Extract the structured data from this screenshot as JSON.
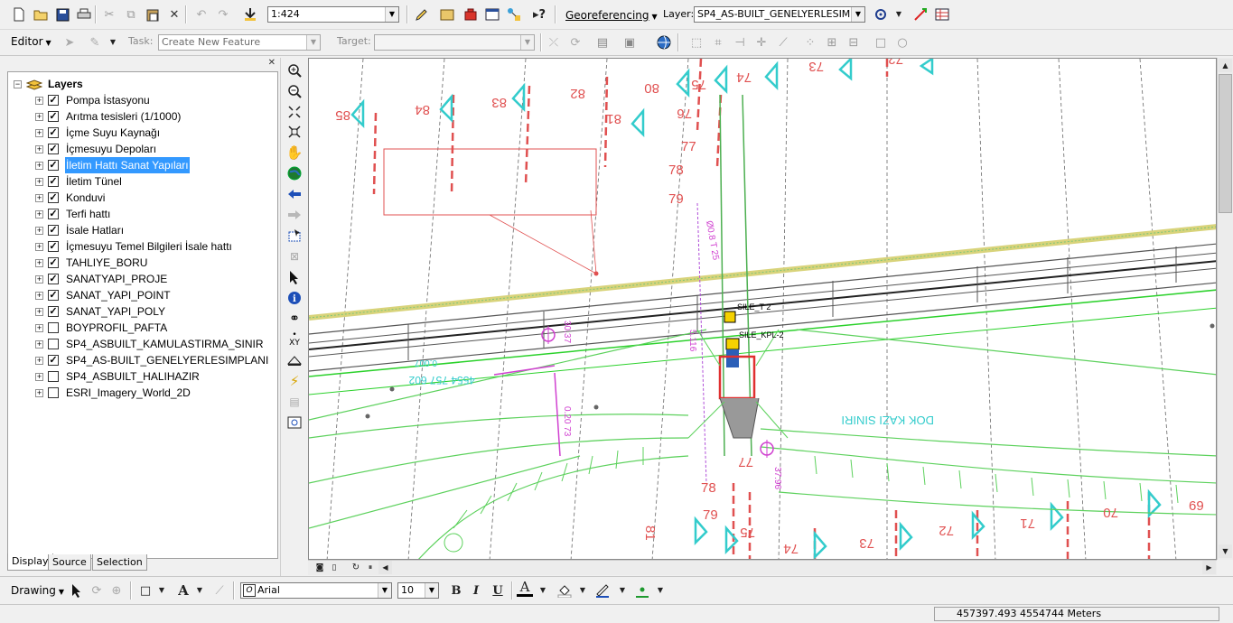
{
  "toolbar": {
    "scale": "1:424",
    "georef_label": "Georeferencing",
    "layer_label": "Layer:",
    "layer_value": "SP4_AS-BUILT_GENELYERLESIM"
  },
  "editor": {
    "editor_label": "Editor",
    "task_label": "Task:",
    "task_value": "Create New Feature",
    "target_label": "Target:",
    "target_value": ""
  },
  "toc": {
    "root": "Layers",
    "layers": [
      {
        "name": "Pompa İstasyonu",
        "checked": true
      },
      {
        "name": "Arıtma tesisleri (1/1000)",
        "checked": true
      },
      {
        "name": "İçme Suyu Kaynağı",
        "checked": true
      },
      {
        "name": "İçmesuyu Depoları",
        "checked": true
      },
      {
        "name": "İletim Hattı Sanat Yapıları",
        "checked": true,
        "selected": true
      },
      {
        "name": "İletim Tünel",
        "checked": true
      },
      {
        "name": "Konduvi",
        "checked": true
      },
      {
        "name": "Terfi hattı",
        "checked": true
      },
      {
        "name": "İsale Hatları",
        "checked": true
      },
      {
        "name": "İçmesuyu Temel Bilgileri İsale hattı",
        "checked": true
      },
      {
        "name": "TAHLIYE_BORU",
        "checked": true
      },
      {
        "name": "SANATYAPI_PROJE",
        "checked": true
      },
      {
        "name": "SANAT_YAPI_POINT",
        "checked": true
      },
      {
        "name": "SANAT_YAPI_POLY",
        "checked": true
      },
      {
        "name": "BOYPROFIL_PAFTA",
        "checked": false
      },
      {
        "name": "SP4_ASBUILT_KAMULASTIRMA_SINIR",
        "checked": false
      },
      {
        "name": "SP4_AS-BUILT_GENELYERLESIMPLANI",
        "checked": true
      },
      {
        "name": "SP4_ASBUILT_HALIHAZIR",
        "checked": false
      },
      {
        "name": "ESRI_Imagery_World_2D",
        "checked": false
      }
    ],
    "tabs": {
      "display": "Display",
      "source": "Source",
      "selection": "Selection"
    }
  },
  "map": {
    "top_numbers": [
      "85",
      "84",
      "83",
      "82",
      "81",
      "80",
      "76",
      "75",
      "74",
      "73",
      "72"
    ],
    "mid_numbers": [
      "77",
      "78",
      "79"
    ],
    "bottom_numbers": [
      "78",
      "77",
      "81",
      "79",
      "75",
      "74",
      "73",
      "72",
      "71",
      "70",
      "69"
    ],
    "label_sile_t2": "SILE_T 2",
    "label_sile_kpl2": "SILE_KPL-2",
    "label_dim": "0.007",
    "label_coord_rotated": "4554 757 602",
    "label_boundary": "DOK KAZI SINIRI",
    "label_small_1": "37.96",
    "label_small_2": "30.37",
    "label_small_3": "0.20 73",
    "label_small_4": "5.116",
    "label_small_5": "Ø0.8 T 25"
  },
  "drawing": {
    "drawing_label": "Drawing",
    "font_name": "Arial",
    "font_size": "10",
    "bold": "B",
    "italic": "I",
    "underline": "U",
    "font_color_glyph": "A"
  },
  "status": {
    "coordinates": "457397.493  4554744 Meters"
  },
  "colors": {
    "selection": "#3399ff",
    "map_green": "#22cc22",
    "map_cyan": "#33cccc",
    "map_red": "#e05050"
  }
}
